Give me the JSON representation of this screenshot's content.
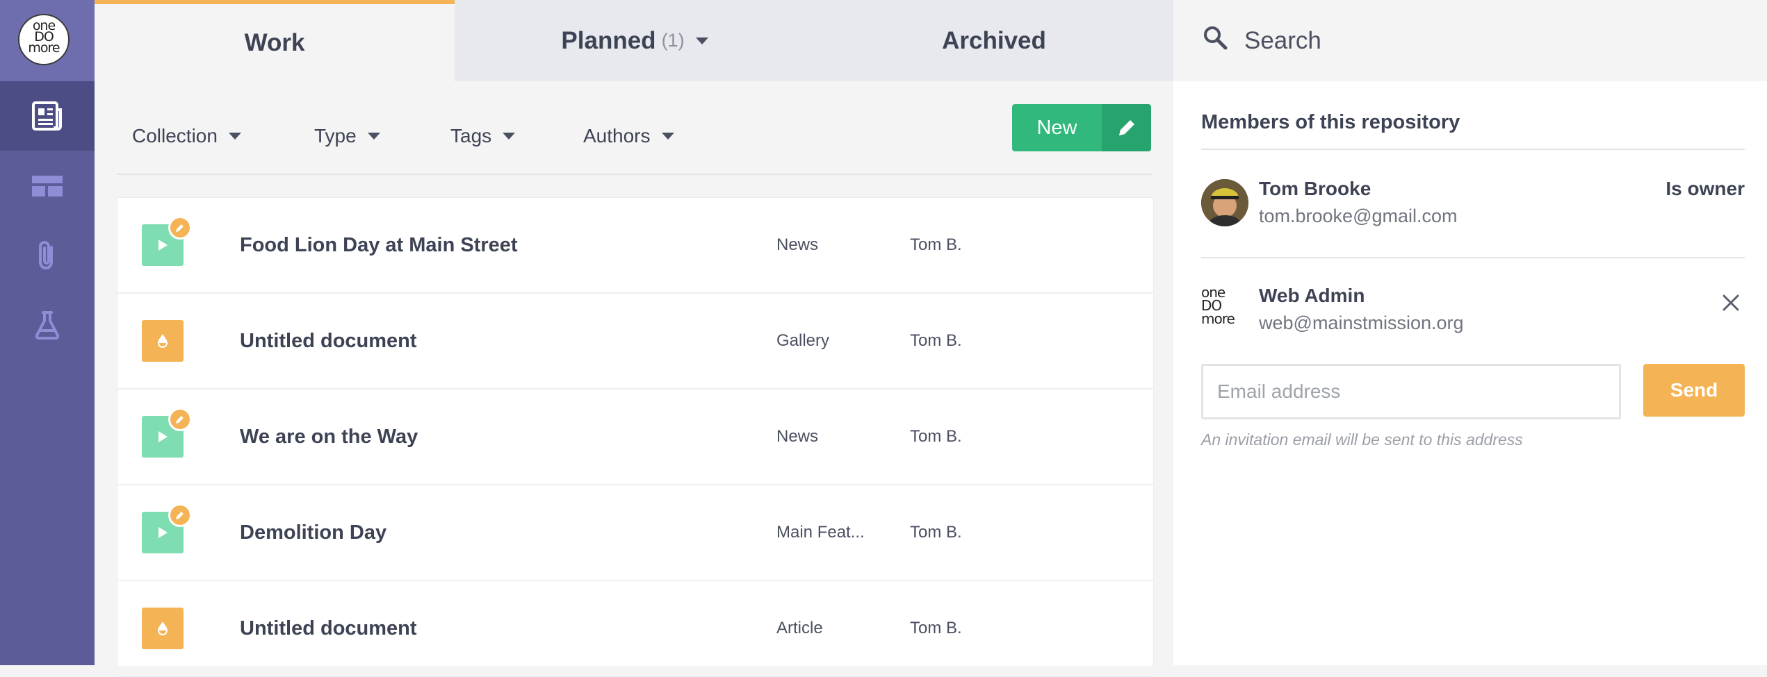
{
  "rail": {
    "logo_text": "one do more",
    "items": [
      {
        "name": "newspaper-icon",
        "active": true
      },
      {
        "name": "layout-icon",
        "active": false
      },
      {
        "name": "paperclip-icon",
        "active": false
      },
      {
        "name": "flask-icon",
        "active": false
      }
    ]
  },
  "tabs": {
    "work": "Work",
    "planned": "Planned",
    "planned_count": "(1)",
    "archived": "Archived"
  },
  "filters": {
    "collection": "Collection",
    "type": "Type",
    "tags": "Tags",
    "authors": "Authors",
    "new_label": "New"
  },
  "documents": [
    {
      "title": "Food Lion Day at Main Street",
      "type": "News",
      "author": "Tom B.",
      "kind": "news",
      "draft": true
    },
    {
      "title": "Untitled document",
      "type": "Gallery",
      "author": "Tom B.",
      "kind": "gallery",
      "draft": false
    },
    {
      "title": "We are on the Way",
      "type": "News",
      "author": "Tom B.",
      "kind": "news",
      "draft": true
    },
    {
      "title": "Demolition Day",
      "type": "Main Feat...",
      "author": "Tom B.",
      "kind": "news",
      "draft": true
    },
    {
      "title": "Untitled document",
      "type": "Article",
      "author": "Tom B.",
      "kind": "gallery",
      "draft": false
    }
  ],
  "search": {
    "placeholder": "Search"
  },
  "members": {
    "title": "Members of this repository",
    "list": [
      {
        "name": "Tom Brooke",
        "email": "tom.brooke@gmail.com",
        "role": "Is owner"
      },
      {
        "name": "Web Admin",
        "email": "web@mainstmission.org"
      }
    ],
    "invite_placeholder": "Email address",
    "send_label": "Send",
    "hint": "An invitation email will be sent to this address"
  },
  "colors": {
    "rail": "#5c5c99",
    "accent_orange": "#f4b355",
    "accent_green": "#30b87d",
    "news_thumb": "#7fddb2"
  }
}
